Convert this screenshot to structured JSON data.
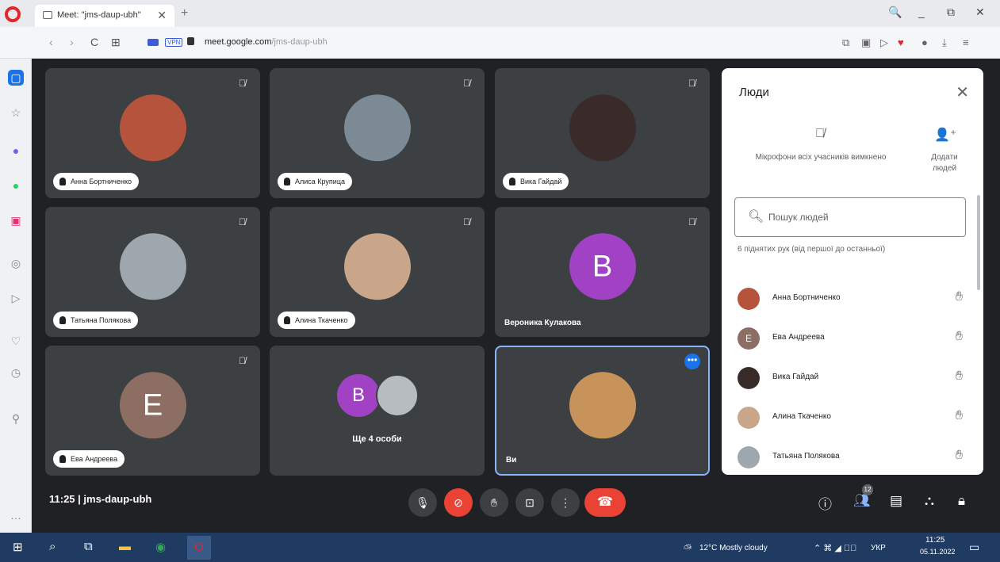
{
  "browser": {
    "tab_title": "Meet: \"jms-daup-ubh\"",
    "tab_close": "✕",
    "new_tab": "+",
    "url_domain": "meet.google.com",
    "url_path": "/jms-daup-ubh",
    "vpn_label": "VPN",
    "window_controls": [
      "🔍",
      "_",
      "⧉",
      "✕"
    ]
  },
  "tiles": [
    {
      "name": "Анна Бортниченко",
      "avatar_color": "#b5533c",
      "initial": ""
    },
    {
      "name": "Алиса Крупица",
      "avatar_color": "#7b8a94",
      "initial": ""
    },
    {
      "name": "Вика Гайдай",
      "avatar_color": "#3a2b2b",
      "initial": ""
    },
    {
      "name": "Татьяна Полякова",
      "avatar_color": "#9ea7ad",
      "initial": ""
    },
    {
      "name": "Алина Ткаченко",
      "avatar_color": "#c9a58a",
      "initial": ""
    },
    {
      "name": "Вероника Кулакова",
      "avatar_color": "#a142c4",
      "initial": "B"
    },
    {
      "name": "Ева Андреева",
      "avatar_color": "#8d6e63",
      "initial": "E"
    },
    {
      "more_label": "Ще 4 особи",
      "avatar_color": "#a142c4",
      "initial": "B"
    },
    {
      "name": "Ви",
      "avatar_color": "#c7935a",
      "initial": ""
    }
  ],
  "panel": {
    "title": "Люди",
    "mute_all_text": "Мікрофони всіх учасників вимкнено",
    "add_people_text": "Додати людей",
    "search_placeholder": "Пошук людей",
    "hands_label": "6 піднятих рук (від першої до останньої)",
    "people": [
      {
        "name": "Анна Бортниченко",
        "color": "#b5533c",
        "initial": ""
      },
      {
        "name": "Ева Андреева",
        "color": "#8d6e63",
        "initial": "E"
      },
      {
        "name": "Вика Гайдай",
        "color": "#3a2b2b",
        "initial": ""
      },
      {
        "name": "Алина Ткаченко",
        "color": "#c9a58a",
        "initial": ""
      },
      {
        "name": "Татьяна Полякова",
        "color": "#9ea7ad",
        "initial": ""
      }
    ]
  },
  "bottom": {
    "meeting_info": "11:25  |  jms-daup-ubh",
    "people_badge": "12"
  },
  "taskbar": {
    "weather": "12°C  Mostly cloudy",
    "lang": "УКР",
    "time": "11:25",
    "date": "05.11.2022"
  }
}
